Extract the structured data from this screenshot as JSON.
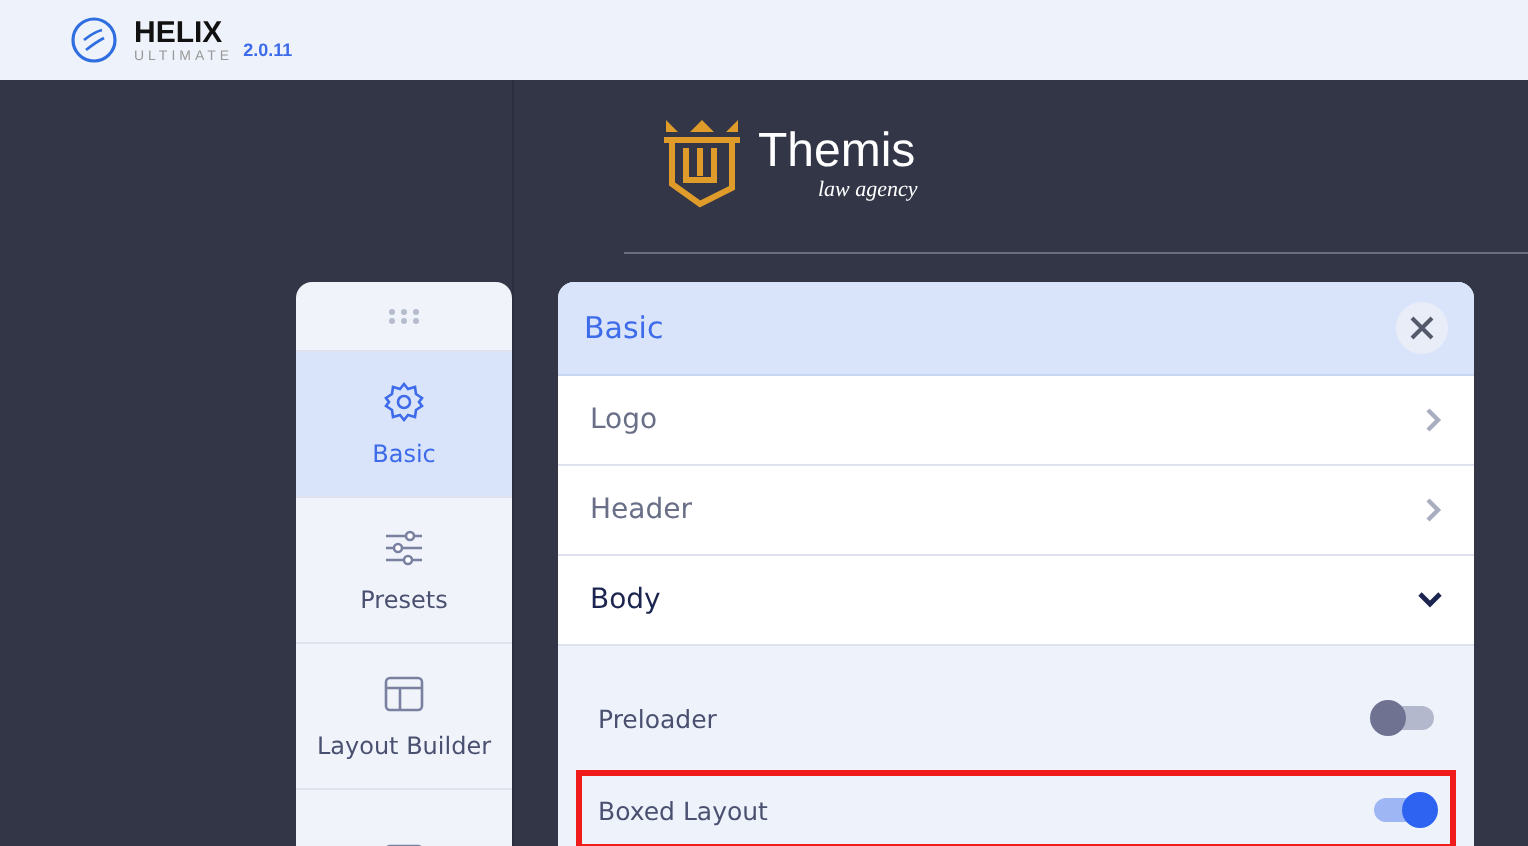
{
  "topbar": {
    "brand": "HELIX",
    "subtitle": "ULTIMATE",
    "version": "2.0.11"
  },
  "site_preview": {
    "logo_name": "Themis",
    "logo_tagline": "law agency"
  },
  "sidebar": {
    "items": [
      {
        "label": "Basic",
        "selected": true
      },
      {
        "label": "Presets",
        "selected": false
      },
      {
        "label": "Layout Builder",
        "selected": false
      },
      {
        "selected": false
      }
    ]
  },
  "panel": {
    "title": "Basic",
    "sections": [
      {
        "label": "Logo",
        "expanded": false
      },
      {
        "label": "Header",
        "expanded": false
      },
      {
        "label": "Body",
        "expanded": true,
        "options": [
          {
            "label": "Preloader",
            "on": false,
            "highlighted": false
          },
          {
            "label": "Boxed Layout",
            "on": true,
            "highlighted": true
          }
        ]
      }
    ]
  }
}
